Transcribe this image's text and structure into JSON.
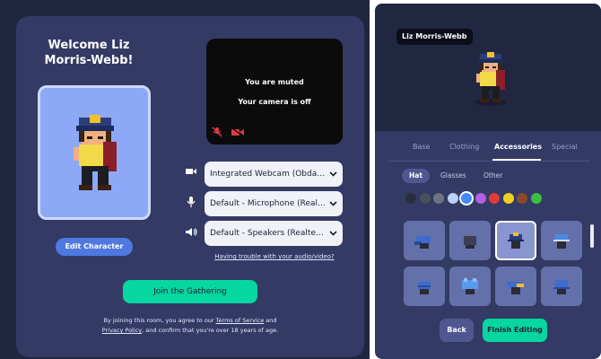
{
  "welcome": {
    "text": "Welcome Liz Morris-Webb!"
  },
  "avatar": {
    "edit_label": "Edit Character"
  },
  "video": {
    "muted_text": "You are muted",
    "camera_off_text": "Your camera is off"
  },
  "devices": {
    "camera": "Integrated Webcam (Obda:...",
    "microphone": "Default - Microphone (Realt...",
    "speakers": "Default - Speakers (Realtek..."
  },
  "trouble_link": "Having trouble with your audio/video?",
  "join_label": "Join the Gathering",
  "legal": {
    "prefix": "By joining this room, you agree to our ",
    "tos": "Terms of Service",
    "and": " and",
    "privacy": "Privacy Policy",
    "suffix": ", and confirm that you're over 18 years of age."
  },
  "editor": {
    "name_tag": "Liz Morris-Webb",
    "tabs": [
      "Base",
      "Clothing",
      "Accessories",
      "Special"
    ],
    "active_tab": "Accessories",
    "subtabs": [
      "Hat",
      "Glasses",
      "Other"
    ],
    "active_subtab": "Hat",
    "colors": [
      "#2a2f3f",
      "#4a4e5a",
      "#6f7380",
      "#bcd0ff",
      "#3d8bff",
      "#b060e0",
      "#e03a3a",
      "#f0d020",
      "#8b4a2a",
      "#3cc040"
    ],
    "selected_color": "#3d8bff",
    "back_label": "Back",
    "finish_label": "Finish Editing"
  }
}
